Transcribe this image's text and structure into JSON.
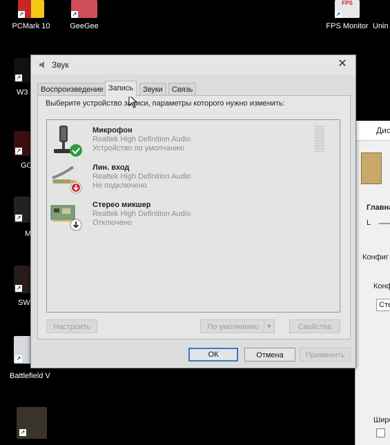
{
  "desktop": {
    "icons": [
      {
        "label": "PCMark 10"
      },
      {
        "label": "GeeGee"
      },
      {
        "label": "FPS Monitor"
      },
      {
        "label": "Unin"
      },
      {
        "label": "W3"
      },
      {
        "label": "GO"
      },
      {
        "label": "M"
      },
      {
        "label": "SW"
      },
      {
        "label": "Battlefield V"
      }
    ]
  },
  "background_window": {
    "title": "Диспетч",
    "section_main": "Главна",
    "left_label": "L",
    "config_tab": "Конфиг",
    "config_label": "Конф",
    "config_value": "Сте",
    "wide_label": "Широ"
  },
  "dialog": {
    "title": "Звук",
    "close_glyph": "✕",
    "tabs": [
      {
        "label": "Воспроизведение",
        "active": false
      },
      {
        "label": "Запись",
        "active": true
      },
      {
        "label": "Звуки",
        "active": false
      },
      {
        "label": "Связь",
        "active": false
      }
    ],
    "instruction": "Выберите устройство записи, параметры которого нужно изменить:",
    "devices": [
      {
        "name": "Микрофон",
        "driver": "Realtek High Definition Audio",
        "status": "Устройство по умолчанию",
        "badge": "check-badge-icon"
      },
      {
        "name": "Лин. вход",
        "driver": "Realtek High Definition Audio",
        "status": "Не подключено",
        "badge": "red-down-badge-icon"
      },
      {
        "name": "Стерео микшер",
        "driver": "Realtek High Definition Audio",
        "status": "Отключено",
        "badge": "disabled-down-badge-icon"
      }
    ],
    "buttons": {
      "configure": "Настроить",
      "set_default": "По умолчанию",
      "properties": "Свойства",
      "ok": "ОК",
      "cancel": "Отмена",
      "apply": "Применить"
    }
  },
  "colors": {
    "dialog_bg": "#dcdedd",
    "accent_focus": "#3a78c6",
    "default_check": "#2e9b3e",
    "unplugged_badge": "#c62828"
  }
}
